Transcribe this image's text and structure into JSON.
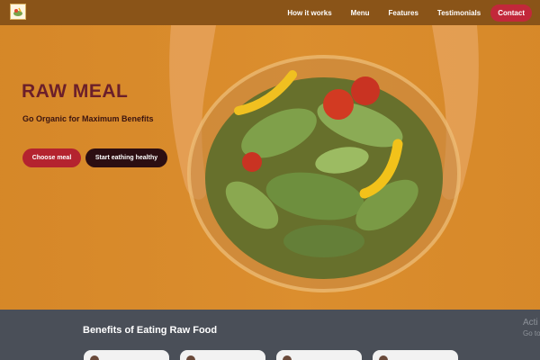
{
  "nav": {
    "logo_icon": "salad-logo-icon",
    "links": [
      "How it works",
      "Menu",
      "Features",
      "Testimonials"
    ],
    "contact_label": "Contact"
  },
  "hero": {
    "title": "RAW MEAL",
    "subtitle": "Go Organic for Maximum Benefits",
    "choose_label": "Choose meal",
    "start_label": "Start eathing healthy"
  },
  "benefits": {
    "title": "Benefits of Eating Raw Food"
  },
  "watermark": {
    "line1": "Acti",
    "line2": "Go to"
  },
  "colors": {
    "nav_bg": "#8a5418",
    "hero_bg": "#d98b2b",
    "accent_red": "#c2283a",
    "dark_button": "#2c0e12",
    "section_bg": "#4a4f58"
  }
}
